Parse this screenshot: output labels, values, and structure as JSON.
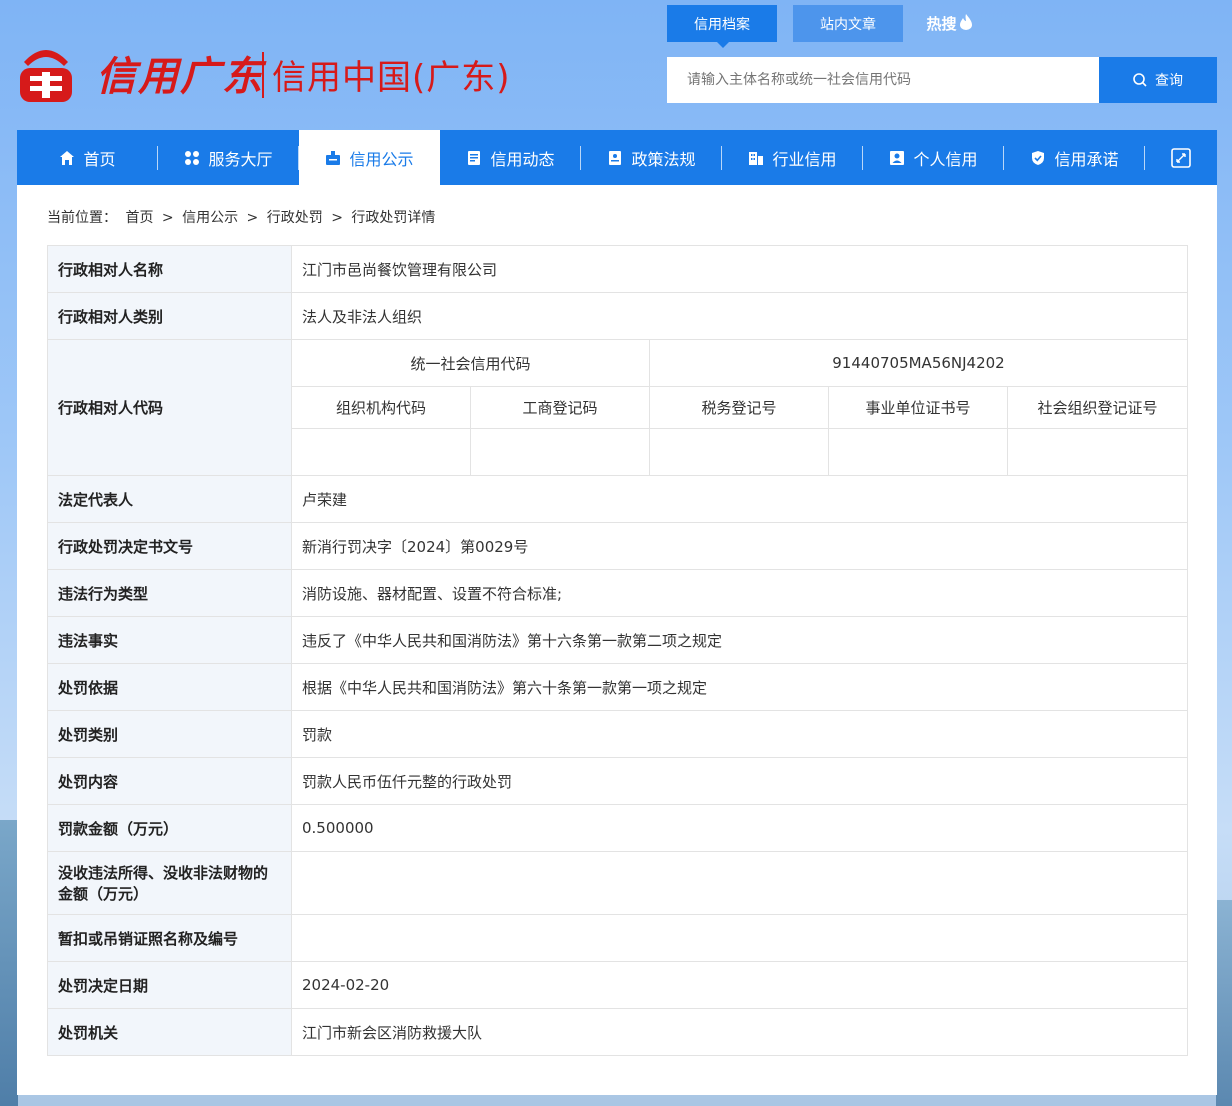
{
  "brand": {
    "script": "信用广东",
    "main": "信用中国(广东)"
  },
  "top_tabs": [
    {
      "label": "信用档案"
    },
    {
      "label": "站内文章"
    },
    {
      "label": "热搜"
    }
  ],
  "search": {
    "placeholder": "请输入主体名称或统一社会信用代码",
    "button": "查询"
  },
  "nav": [
    {
      "label": "首页",
      "icon": "home-icon"
    },
    {
      "label": "服务大厅",
      "icon": "grid-icon"
    },
    {
      "label": "信用公示",
      "icon": "bulletin-icon"
    },
    {
      "label": "信用动态",
      "icon": "news-icon"
    },
    {
      "label": "政策法规",
      "icon": "document-icon"
    },
    {
      "label": "行业信用",
      "icon": "building-icon"
    },
    {
      "label": "个人信用",
      "icon": "id-card-icon"
    },
    {
      "label": "信用承诺",
      "icon": "shield-icon"
    }
  ],
  "breadcrumb": {
    "prefix": "当前位置：",
    "items": [
      "首页",
      "信用公示",
      "行政处罚",
      "行政处罚详情"
    ],
    "sep": ">"
  },
  "record": {
    "name_label": "行政相对人名称",
    "name": "江门市邑尚餐饮管理有限公司",
    "type_label": "行政相对人类别",
    "type": "法人及非法人组织",
    "code_label": "行政相对人代码",
    "uscc_label": "统一社会信用代码",
    "uscc": "91440705MA56NJ4202",
    "code_headers": [
      "组织机构代码",
      "工商登记码",
      "税务登记号",
      "事业单位证书号",
      "社会组织登记证号"
    ],
    "rows": [
      {
        "label": "法定代表人",
        "value": "卢荣建"
      },
      {
        "label": "行政处罚决定书文号",
        "value": "新消行罚决字〔2024〕第0029号"
      },
      {
        "label": "违法行为类型",
        "value": "消防设施、器材配置、设置不符合标准;"
      },
      {
        "label": "违法事实",
        "value": "违反了《中华人民共和国消防法》第十六条第一款第二项之规定"
      },
      {
        "label": "处罚依据",
        "value": "根据《中华人民共和国消防法》第六十条第一款第一项之规定"
      },
      {
        "label": "处罚类别",
        "value": "罚款"
      },
      {
        "label": "处罚内容",
        "value": "罚款人民币伍仟元整的行政处罚"
      },
      {
        "label": "罚款金额（万元）",
        "value": "0.500000"
      },
      {
        "label": "没收违法所得、没收非法财物的金额（万元）",
        "value": ""
      },
      {
        "label": "暂扣或吊销证照名称及编号",
        "value": ""
      },
      {
        "label": "处罚决定日期",
        "value": "2024-02-20"
      },
      {
        "label": "处罚机关",
        "value": "江门市新会区消防救援大队"
      }
    ]
  },
  "colors": {
    "primary": "#1a7be8",
    "brand_red": "#d61a1a",
    "label_bg": "#f2f6fb"
  }
}
